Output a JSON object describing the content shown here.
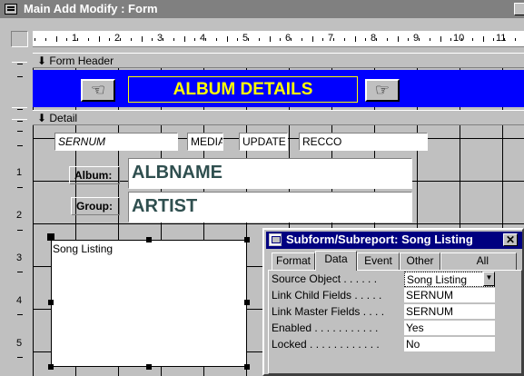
{
  "window": {
    "title": "Main Add Modify : Form"
  },
  "ruler": {
    "marks": [
      "1",
      "2",
      "3",
      "4",
      "5",
      "6",
      "7",
      "8",
      "9",
      "10",
      "11"
    ],
    "vmarks": [
      "1",
      "2",
      "3",
      "4",
      "5"
    ]
  },
  "sections": {
    "form_header": "Form Header",
    "detail": "Detail"
  },
  "header": {
    "title": "ALBUM DETAILS",
    "left_hand": "☜",
    "right_hand": "☞"
  },
  "fields": {
    "sernum": "SERNUM",
    "media": "MEDIA",
    "update": "UPDATE",
    "recco": "RECCO",
    "albname": "ALBNAME",
    "artist": "ARTIST"
  },
  "labels": {
    "album": "Album:",
    "group": "Group:"
  },
  "subform": {
    "label": "Song Listing"
  },
  "property_sheet": {
    "title": "Subform/Subreport: Song Listing",
    "close": "✕",
    "tabs": [
      "Format",
      "Data",
      "Event",
      "Other",
      "All"
    ],
    "selected_tab": "Data",
    "rows": [
      {
        "name": "Source Object . . . . . .",
        "value": "Song Listing"
      },
      {
        "name": "Link Child Fields . . . . .",
        "value": "SERNUM"
      },
      {
        "name": "Link Master Fields . . . .",
        "value": "SERNUM"
      },
      {
        "name": "Enabled . . . . . . . . . . .",
        "value": "Yes"
      },
      {
        "name": "Locked . . . . . . . . . . . .",
        "value": "No"
      }
    ],
    "dropdown": "▼"
  }
}
